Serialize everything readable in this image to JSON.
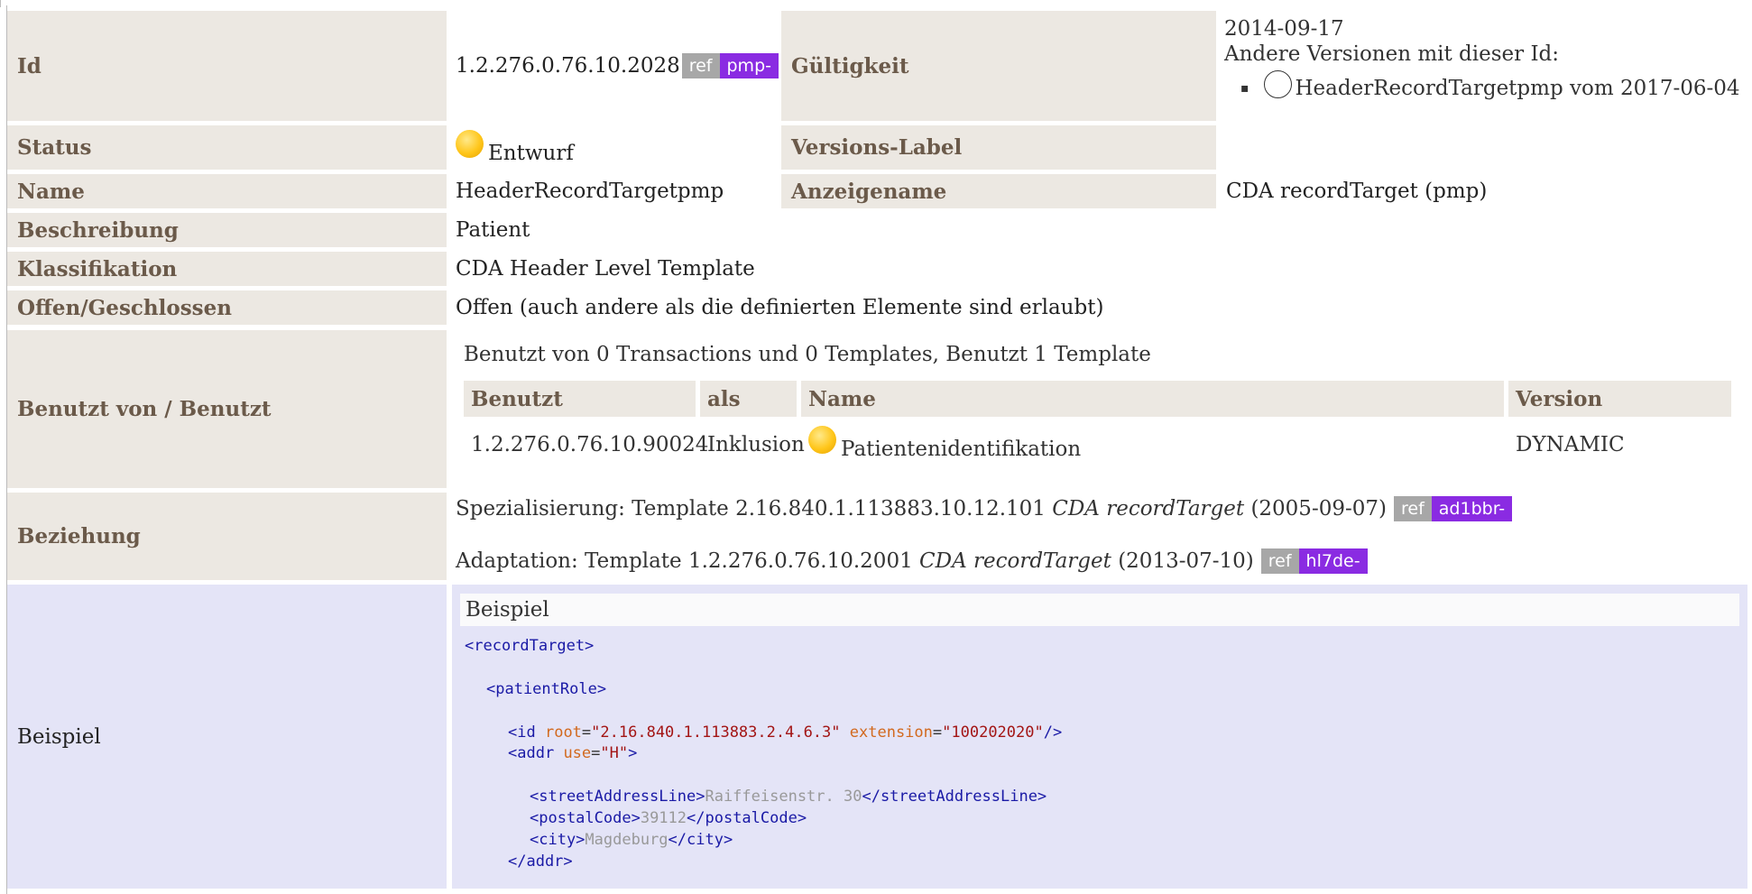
{
  "rows": {
    "id": {
      "label": "Id",
      "value": "1.2.276.0.76.10.2028",
      "tag_ref": "ref",
      "tag_project": "pmp-"
    },
    "validity": {
      "label": "Gültigkeit",
      "date": "2014-09-17",
      "other_versions": "Andere Versionen mit dieser Id:",
      "version_item": "HeaderRecordTargetpmp vom 2017-06-04"
    },
    "status": {
      "label": "Status",
      "value": "Entwurf",
      "icon": "draft-status-icon"
    },
    "version_label": {
      "label": "Versions-Label",
      "value": ""
    },
    "name": {
      "label": "Name",
      "value": "HeaderRecordTargetpmp"
    },
    "display_name": {
      "label": "Anzeigename",
      "value": "CDA recordTarget (pmp)"
    },
    "description": {
      "label": "Beschreibung",
      "value": "Patient"
    },
    "classification": {
      "label": "Klassifikation",
      "value": "CDA Header Level Template"
    },
    "open_closed": {
      "label": "Offen/Geschlossen",
      "value": "Offen (auch andere als die definierten Elemente sind erlaubt)"
    },
    "used_by": {
      "label": "Benutzt von / Benutzt",
      "summary": "Benutzt von 0 Transactions und 0 Templates, Benutzt 1 Template",
      "headers": {
        "used": "Benutzt",
        "as": "als",
        "name": "Name",
        "version": "Version"
      },
      "row": {
        "used": "1.2.276.0.76.10.90024",
        "as": "Inklusion",
        "name": "Patientenidentifikation",
        "version": "DYNAMIC"
      }
    },
    "relationship": {
      "label": "Beziehung",
      "spec_prefix": "Spezialisierung: Template 2.16.840.1.113883.10.12.101",
      "spec_name": "CDA recordTarget",
      "spec_date": "(2005-09-07)",
      "spec_ref": "ref",
      "spec_project": "ad1bbr-",
      "adapt_prefix": "Adaptation: Template 1.2.276.0.76.10.2001",
      "adapt_name": "CDA recordTarget",
      "adapt_date": "(2013-07-10)",
      "adapt_ref": "ref",
      "adapt_project": "hl7de-"
    },
    "example": {
      "label": "Beispiel",
      "box_title": "Beispiel",
      "code": {
        "l1": "<recordTarget>",
        "l2": "<patientRole>",
        "l3_tag": "<id",
        "l3_a1": "root",
        "l3_v1": "\"2.16.840.1.113883.2.4.6.3\"",
        "l3_a2": "extension",
        "l3_v2": "\"100202020\"",
        "l3_end": "/>",
        "l4_tag": "<addr",
        "l4_a1": "use",
        "l4_v1": "\"H\"",
        "l4_end": ">",
        "l5_open": "<streetAddressLine>",
        "l5_text": "Raiffeisenstr. 30",
        "l5_close": "</streetAddressLine>",
        "l6_open": "<postalCode>",
        "l6_text": "39112",
        "l6_close": "</postalCode>",
        "l7_open": "<city>",
        "l7_text": "Magdeburg",
        "l7_close": "</city>",
        "l8": "</addr>"
      }
    }
  },
  "colors": {
    "label_bg": "#ece8e2",
    "label_text": "#6b5a4a",
    "example_bg": "#e4e4f7",
    "ref_tag": "#a7a7a7",
    "project_tag": "#8a2be2"
  }
}
